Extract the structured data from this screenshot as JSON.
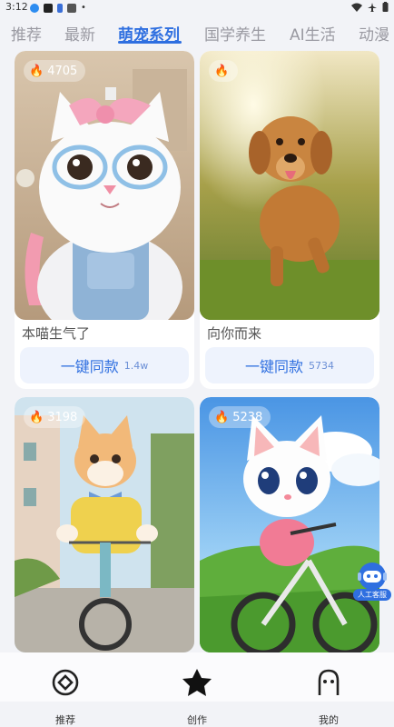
{
  "status_bar": {
    "time": "3:12",
    "dot": "•"
  },
  "tabs": [
    {
      "label": "推荐"
    },
    {
      "label": "最新"
    },
    {
      "label": "萌宠系列"
    },
    {
      "label": "国学养生"
    },
    {
      "label": "AI生活"
    },
    {
      "label": "动漫"
    }
  ],
  "active_tab": "萌宠系列",
  "cards": [
    {
      "heat": "4705",
      "title": "本喵生气了",
      "button_label": "一键同款",
      "button_count": "1.4w",
      "image": "white-kitten-pink-bow-glasses"
    },
    {
      "heat": "",
      "title": "向你而来",
      "button_label": "一键同款",
      "button_count": "5734",
      "image": "golden-retriever-running-on-grass"
    },
    {
      "heat": "3198",
      "image": "orange-kitten-riding-bicycle"
    },
    {
      "heat": "5238",
      "image": "cartoon-white-cat-on-bicycle"
    }
  ],
  "floating_support": {
    "label": "人工客服"
  },
  "bottom_nav": [
    {
      "label": "推荐",
      "icon": "discover-icon"
    },
    {
      "label": "创作",
      "icon": "star-icon"
    },
    {
      "label": "我的",
      "icon": "profile-icon"
    }
  ],
  "colors": {
    "accent": "#2f6fe0",
    "heat": "#ff6a1a",
    "background": "#f2f3f7"
  }
}
